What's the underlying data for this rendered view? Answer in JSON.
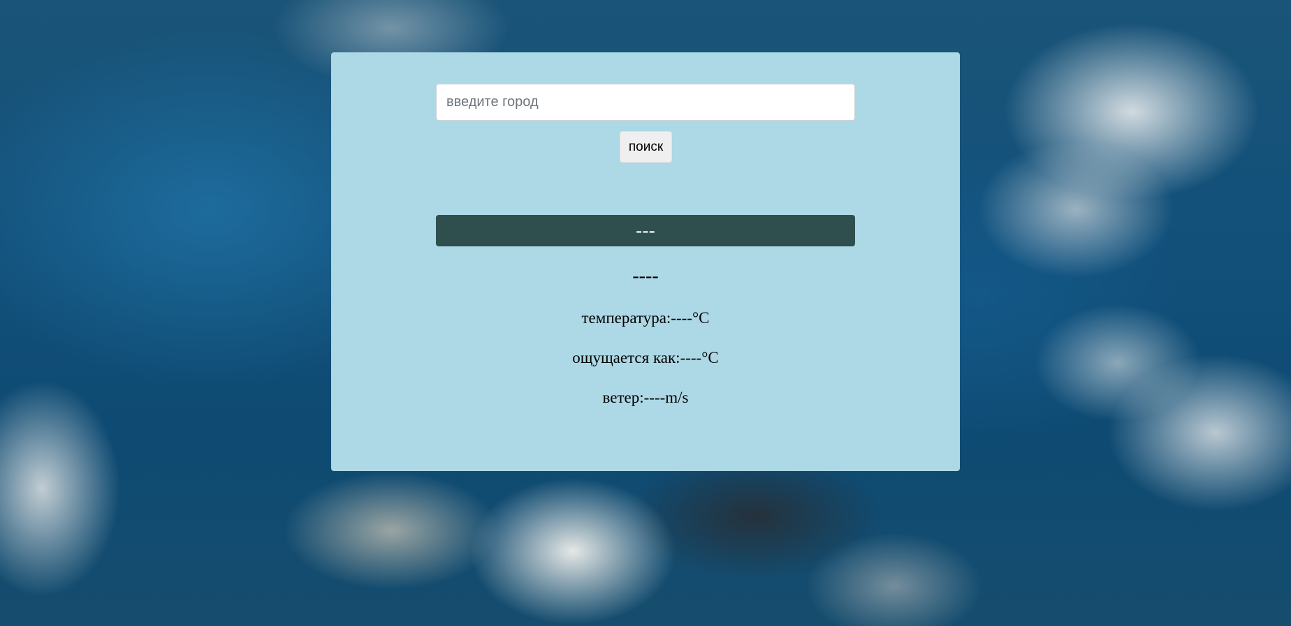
{
  "search": {
    "placeholder": "введите город",
    "value": "",
    "button_label": "поиск"
  },
  "weather": {
    "city": "---",
    "description": "----",
    "temperature_label": "температура:",
    "temperature_value": "----",
    "temperature_unit": "°C",
    "feels_like_label": "ощущается как:",
    "feels_like_value": "----",
    "feels_like_unit": "°C",
    "wind_label": "ветер:",
    "wind_value": "----",
    "wind_unit": "m/s"
  },
  "colors": {
    "card_background": "#add8e6",
    "city_bar_background": "#2f4f4f",
    "city_text": "#ffffff",
    "button_background": "#efefef"
  }
}
